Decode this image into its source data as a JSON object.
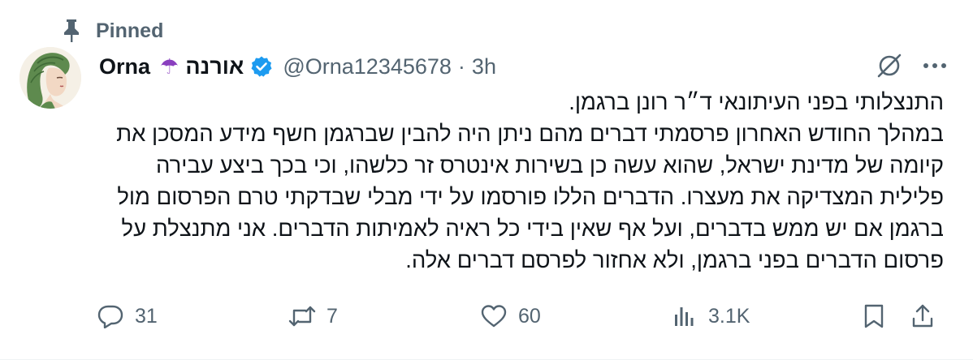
{
  "pinned": {
    "label": "Pinned",
    "icon": "pin-icon"
  },
  "author": {
    "name_en": "Orna",
    "emoji": "☂",
    "name_he": "אורנה",
    "handle": "@Orna12345678",
    "time": "3h",
    "verified": true,
    "verified_color": "#1d9bf0"
  },
  "tweet": {
    "lines": [
      "התנצלותי בפני העיתונאי ד״ר רונן ברגמן.",
      "במהלך החודש האחרון פרסמתי דברים מהם ניתן היה להבין שברגמן חשף מידע המסכן את",
      "קיומה של מדינת ישראל, שהוא עשה כן בשירות אינטרס זר כלשהו, וכי בכך ביצע עבירה",
      "פלילית המצדיקה את מעצרו. הדברים הללו פורסמו על ידי מבלי שבדקתי טרם הפרסום מול",
      "ברגמן אם יש ממש בדברים, ועל אף שאין בידי כל ראיה לאמיתות הדברים. אני מתנצלת על",
      "פרסום הדברים בפני ברגמן, ולא אחזור לפרסם דברים אלה."
    ]
  },
  "actions": {
    "replies": "31",
    "retweets": "7",
    "likes": "60",
    "views": "3.1K"
  },
  "colors": {
    "text": "#0f1419",
    "secondary": "#536471",
    "accent": "#1d9bf0"
  }
}
